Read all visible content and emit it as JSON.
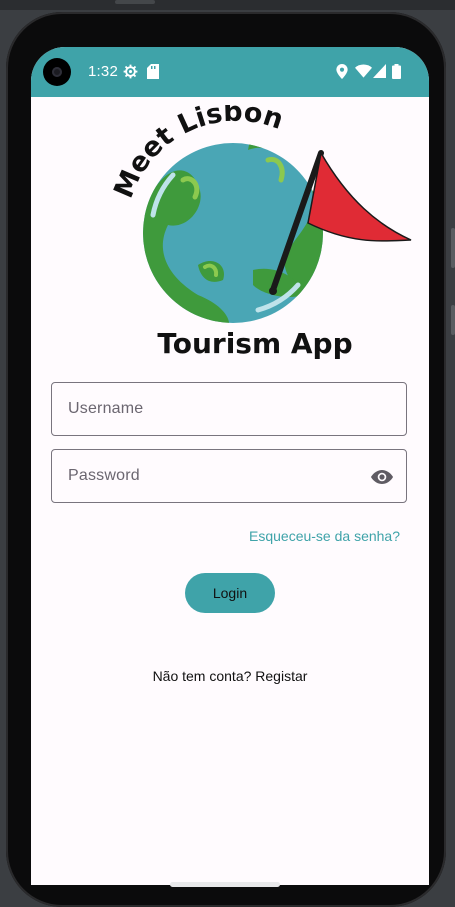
{
  "status_bar": {
    "time": "1:32",
    "icons": [
      "settings-icon",
      "sd-card-icon",
      "location-icon",
      "wifi-icon",
      "signal-icon",
      "battery-icon"
    ]
  },
  "logo": {
    "arc_text": "Meet Lisbon",
    "subtitle": "Tourism App"
  },
  "form": {
    "username_placeholder": "Username",
    "password_placeholder": "Password",
    "forgot_password": "Esqueceu-se da senha?",
    "login_label": "Login",
    "register_prompt": "Não tem conta? Registar"
  },
  "colors": {
    "accent": "#3fa3a9",
    "background": "#fffbfe",
    "flag": "#e02b35",
    "ocean": "#4aa6b5",
    "land": "#3f9a3c"
  }
}
